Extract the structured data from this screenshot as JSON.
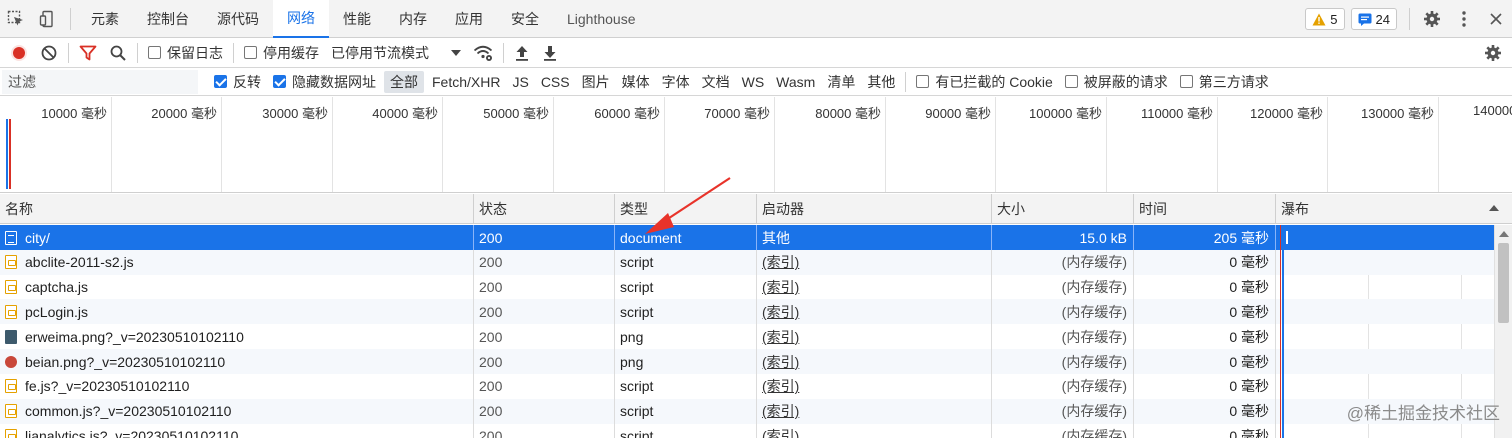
{
  "tabbar": {
    "tabs": [
      {
        "key": "elements",
        "label": "元素"
      },
      {
        "key": "console",
        "label": "控制台"
      },
      {
        "key": "sources",
        "label": "源代码"
      },
      {
        "key": "network",
        "label": "网络"
      },
      {
        "key": "performance",
        "label": "性能"
      },
      {
        "key": "memory",
        "label": "内存"
      },
      {
        "key": "application",
        "label": "应用"
      },
      {
        "key": "security",
        "label": "安全"
      },
      {
        "key": "lighthouse",
        "label": "Lighthouse"
      }
    ],
    "warnings_count": "5",
    "messages_count": "24"
  },
  "toolbar": {
    "preserve_log": "保留日志",
    "disable_cache": "停用缓存",
    "throttling": "已停用节流模式"
  },
  "filter": {
    "placeholder": "过滤",
    "invert": "反转",
    "hide_data_urls": "隐藏数据网址",
    "types": [
      "全部",
      "Fetch/XHR",
      "JS",
      "CSS",
      "图片",
      "媒体",
      "字体",
      "文档",
      "WS",
      "Wasm",
      "清单",
      "其他"
    ],
    "blocked_cookies": "有已拦截的 Cookie",
    "blocked_requests": "被屏蔽的请求",
    "third_party": "第三方请求"
  },
  "overview": {
    "ticks": [
      "10000 毫秒",
      "20000 毫秒",
      "30000 毫秒",
      "40000 毫秒",
      "50000 毫秒",
      "60000 毫秒",
      "70000 毫秒",
      "80000 毫秒",
      "90000 毫秒",
      "100000 毫秒",
      "110000 毫秒",
      "120000 毫秒",
      "130000 毫秒",
      "140000"
    ]
  },
  "table": {
    "columns": {
      "name": "名称",
      "status": "状态",
      "type": "类型",
      "initiator": "启动器",
      "size": "大小",
      "time": "时间",
      "waterfall": "瀑布"
    },
    "rows": [
      {
        "name": "city/",
        "status": "200",
        "type": "document",
        "initiator": "其他",
        "size": "15.0 kB",
        "time": "205 毫秒",
        "icon": "doc"
      },
      {
        "name": "abclite-2011-s2.js",
        "status": "200",
        "type": "script",
        "initiator": "(索引)",
        "size": "(内存缓存)",
        "time": "0 毫秒",
        "icon": "js"
      },
      {
        "name": "captcha.js",
        "status": "200",
        "type": "script",
        "initiator": "(索引)",
        "size": "(内存缓存)",
        "time": "0 毫秒",
        "icon": "js"
      },
      {
        "name": "pcLogin.js",
        "status": "200",
        "type": "script",
        "initiator": "(索引)",
        "size": "(内存缓存)",
        "time": "0 毫秒",
        "icon": "js"
      },
      {
        "name": "erweima.png?_v=20230510102110",
        "status": "200",
        "type": "png",
        "initiator": "(索引)",
        "size": "(内存缓存)",
        "time": "0 毫秒",
        "icon": "img"
      },
      {
        "name": "beian.png?_v=20230510102110",
        "status": "200",
        "type": "png",
        "initiator": "(索引)",
        "size": "(内存缓存)",
        "time": "0 毫秒",
        "icon": "img2"
      },
      {
        "name": "fe.js?_v=20230510102110",
        "status": "200",
        "type": "script",
        "initiator": "(索引)",
        "size": "(内存缓存)",
        "time": "0 毫秒",
        "icon": "js"
      },
      {
        "name": "common.js?_v=20230510102110",
        "status": "200",
        "type": "script",
        "initiator": "(索引)",
        "size": "(内存缓存)",
        "time": "0 毫秒",
        "icon": "js"
      },
      {
        "name": "lianalytics.js?_v=20230510102110",
        "status": "200",
        "type": "script",
        "initiator": "(索引)",
        "size": "(内存缓存)",
        "time": "0 毫秒",
        "icon": "js"
      }
    ]
  },
  "watermark": "@稀土掘金技术社区",
  "colors": {
    "accent": "#1a73e8",
    "record": "#d93025",
    "filter_icon": "#d93025",
    "warning": "#e5a100"
  }
}
